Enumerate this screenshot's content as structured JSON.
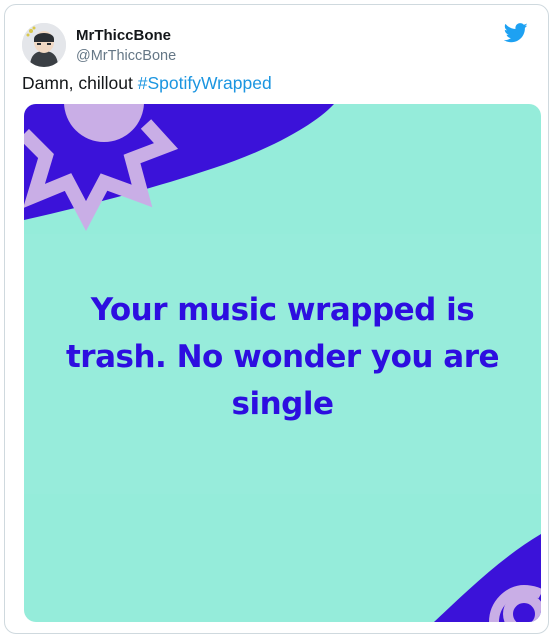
{
  "tweet": {
    "author_name": "MrThiccBone",
    "author_handle": "@MrThiccBone",
    "text_prefix": "Damn, chillout ",
    "hashtag": "#SpotifyWrapped",
    "logo_icon": "twitter-bird-icon"
  },
  "media": {
    "message": "Your music wrapped is trash. No wonder you are single",
    "background_color": "#95ecda",
    "accent_color": "#3b12d9",
    "badge_color": "#c9aee6"
  },
  "colors": {
    "link": "#1b95e0",
    "handle": "#657786",
    "twitter_blue": "#1da1f2"
  }
}
